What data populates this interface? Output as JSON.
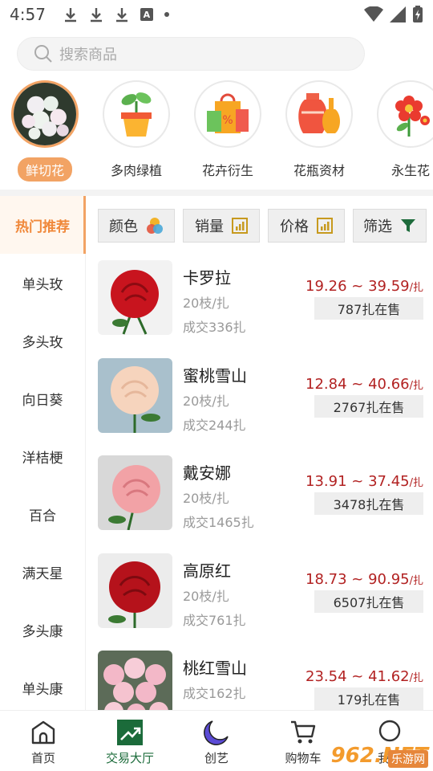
{
  "status_bar": {
    "time": "4:57"
  },
  "search": {
    "placeholder": "搜索商品"
  },
  "categories": [
    {
      "label": "鲜切花",
      "active": true
    },
    {
      "label": "多肉绿植",
      "active": false
    },
    {
      "label": "花卉衍生",
      "active": false
    },
    {
      "label": "花瓶资材",
      "active": false
    },
    {
      "label": "永生花",
      "active": false
    }
  ],
  "side_menu": [
    "热门推荐",
    "单头玫",
    "多头玫",
    "向日葵",
    "洋桔梗",
    "百合",
    "满天星",
    "多头康",
    "单头康"
  ],
  "filters": [
    {
      "label": "颜色",
      "icon": "color-palette-icon"
    },
    {
      "label": "销量",
      "icon": "bar-chart-icon"
    },
    {
      "label": "价格",
      "icon": "bar-chart-icon"
    },
    {
      "label": "筛选",
      "icon": "filter-icon"
    }
  ],
  "products": [
    {
      "name": "卡罗拉",
      "spec": "20枝/扎",
      "sold": "成交336扎",
      "price": "19.26 ~ 39.59",
      "unit": "/扎",
      "stock": "787扎在售",
      "color": "#c8141e"
    },
    {
      "name": "蜜桃雪山",
      "spec": "20枝/扎",
      "sold": "成交244扎",
      "price": "12.84 ~ 40.66",
      "unit": "/扎",
      "stock": "2767扎在售",
      "color": "#f6d4bd"
    },
    {
      "name": "戴安娜",
      "spec": "20枝/扎",
      "sold": "成交1465扎",
      "price": "13.91 ~ 37.45",
      "unit": "/扎",
      "stock": "3478扎在售",
      "color": "#f2a2a6"
    },
    {
      "name": "高原红",
      "spec": "20枝/扎",
      "sold": "成交761扎",
      "price": "18.73 ~ 90.95",
      "unit": "/扎",
      "stock": "6507扎在售",
      "color": "#b5121b"
    },
    {
      "name": "桃红雪山",
      "spec": "",
      "sold": "成交162扎",
      "price": "23.54 ~ 41.62",
      "unit": "/扎",
      "stock": "179扎在售",
      "color": "#f3b8c8"
    }
  ],
  "bottom_nav": [
    {
      "label": "首页",
      "active": false
    },
    {
      "label": "交易大厅",
      "active": true
    },
    {
      "label": "创艺",
      "active": false
    },
    {
      "label": "购物车",
      "active": false
    },
    {
      "label": "我的",
      "active": false
    }
  ],
  "watermark": {
    "logo": "962.NET",
    "text": "乐游网"
  }
}
